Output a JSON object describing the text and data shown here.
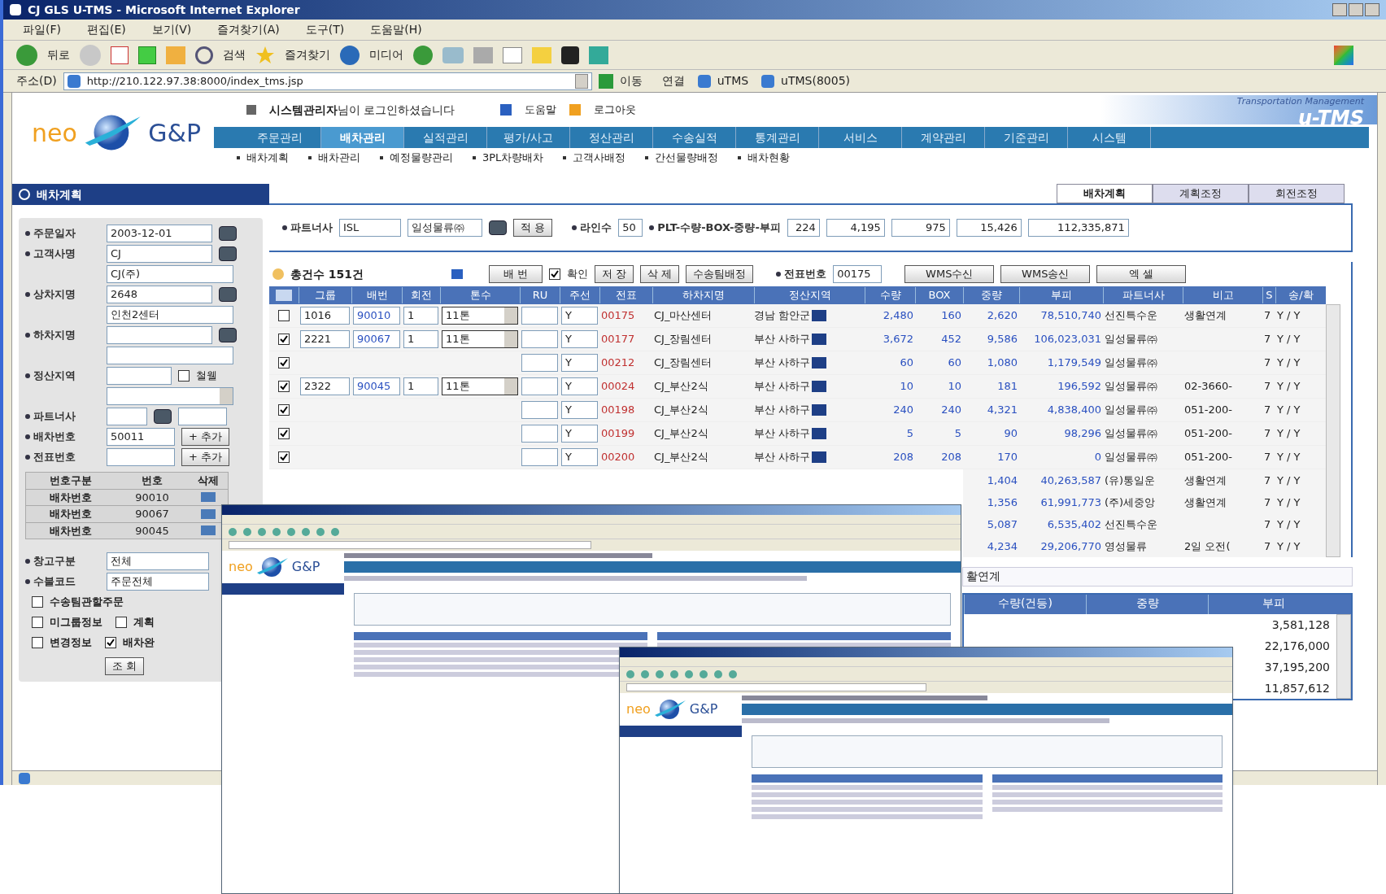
{
  "window": {
    "title": "CJ GLS U-TMS - Microsoft Internet Explorer",
    "menu": [
      "파일(F)",
      "편집(E)",
      "보기(V)",
      "즐겨찾기(A)",
      "도구(T)",
      "도움말(H)"
    ],
    "toolbar": {
      "back": "뒤로",
      "search": "검색",
      "favorites": "즐겨찾기",
      "media": "미디어"
    },
    "address": {
      "label": "주소(D)",
      "url": "http://210.122.97.38:8000/index_tms.jsp",
      "go": "이동",
      "links_label": "연결",
      "links": [
        "uTMS",
        "uTMS(8005)"
      ]
    }
  },
  "header": {
    "logo_left": "neo",
    "logo_right": "G&P",
    "login_message": "**시스템관리자**님이 로그인하셨습니다",
    "help": "도움말",
    "logout": "로그아웃",
    "tagline": "Transportation Management",
    "brand": "u-TMS"
  },
  "nav": [
    {
      "label": "주문관리",
      "selected": false
    },
    {
      "label": "배차관리",
      "selected": true
    },
    {
      "label": "실적관리",
      "selected": false
    },
    {
      "label": "평가/사고",
      "selected": false
    },
    {
      "label": "정산관리",
      "selected": false
    },
    {
      "label": "수송실적",
      "selected": false
    },
    {
      "label": "통계관리",
      "selected": false
    },
    {
      "label": "서비스",
      "selected": false
    },
    {
      "label": "계약관리",
      "selected": false
    },
    {
      "label": "기준관리",
      "selected": false
    },
    {
      "label": "시스템",
      "selected": false
    }
  ],
  "subnav": [
    "배차계획",
    "배차관리",
    "예정물량관리",
    "3PL차량배차",
    "고객사배정",
    "간선물량배정",
    "배차현황"
  ],
  "sidebar": {
    "title": "배차계획",
    "fields": [
      {
        "label": "주문일자",
        "value": "2003-12-01",
        "kind": "lookup"
      },
      {
        "label": "고객사명",
        "value": "CJ",
        "value2": "CJ(주)",
        "kind": "lookup2"
      },
      {
        "label": "상차지명",
        "value": "2648",
        "value2": "인천2센터",
        "kind": "lookup2"
      },
      {
        "label": "하차지명",
        "kind": "lookup2"
      },
      {
        "label": "정산지역",
        "check_label": "철웰",
        "checked": false,
        "kind": "region"
      },
      {
        "label": "파트너사",
        "kind": "partner"
      },
      {
        "label": "배차번호",
        "value": "50011",
        "button": "+ 추가",
        "kind": "add"
      },
      {
        "label": "전표번호",
        "button": "+ 추가",
        "kind": "add"
      }
    ],
    "numbers": {
      "columns": [
        "번호구분",
        "번호",
        "삭제"
      ],
      "rows": [
        [
          "배차번호",
          "90010"
        ],
        [
          "배차번호",
          "90067"
        ],
        [
          "배차번호",
          "90045"
        ]
      ]
    },
    "fields2": [
      {
        "label": "창고구분",
        "value": "전체"
      },
      {
        "label": "수불코드",
        "value": "주문전체"
      }
    ],
    "checks": [
      [
        {
          "label": "수송팀관할주문",
          "checked": false
        }
      ],
      [
        {
          "label": "미그룹정보",
          "checked": false
        },
        {
          "label": "계획",
          "checked": false
        }
      ],
      [
        {
          "label": "변경정보",
          "checked": false
        },
        {
          "label": "배차완",
          "checked": true
        }
      ]
    ],
    "search_button": "조 회"
  },
  "tabs": [
    {
      "label": "배차계획",
      "selected": true
    },
    {
      "label": "계획조정",
      "selected": false
    },
    {
      "label": "회전조정",
      "selected": false
    }
  ],
  "partner_row": {
    "label": "파트너사",
    "code": "ISL",
    "name": "일성물류㈜",
    "apply": "적 용",
    "lines_label": "라인수",
    "lines": "50",
    "totals_label": "PLT-수량-BOX-중량-부피",
    "totals": [
      "224",
      "4,195",
      "975",
      "15,426",
      "112,335,871"
    ]
  },
  "action_bar": {
    "count": "총건수 151건",
    "number_button": "배 번",
    "confirm": {
      "label": "확인",
      "checked": true
    },
    "buttons": [
      "저 장",
      "삭 제",
      "수송팀배정"
    ],
    "slip_label": "전표번호",
    "slip": "00175",
    "buttons2": [
      "WMS수신",
      "WMS송신",
      "엑 셀"
    ]
  },
  "table": {
    "columns": [
      "그룹",
      "배번",
      "회전",
      "톤수",
      "RU",
      "주선",
      "전표",
      "하차지명",
      "정산지역",
      "수량",
      "BOX",
      "중량",
      "부피",
      "파트너사",
      "비고",
      "S",
      "송/확"
    ],
    "rows": [
      {
        "checked": false,
        "cells": [
          "1016",
          "90010",
          "1",
          "11톤",
          "",
          "Y",
          "00175",
          "CJ_마산센터",
          "경남 함안군",
          "2,480",
          "160",
          "2,620",
          "78,510,740",
          "선진특수운",
          "생활연계",
          "7",
          "Y / Y"
        ]
      },
      {
        "checked": true,
        "cells": [
          "2221",
          "90067",
          "1",
          "11톤",
          "",
          "Y",
          "00177",
          "CJ_장림센터",
          "부산 사하구",
          "3,672",
          "452",
          "9,586",
          "106,023,031",
          "일성물류㈜",
          "",
          "7",
          "Y / Y"
        ]
      },
      {
        "checked": true,
        "cells": [
          "",
          "",
          "",
          "",
          "",
          "Y",
          "00212",
          "CJ_장림센터",
          "부산 사하구",
          "60",
          "60",
          "1,080",
          "1,179,549",
          "일성물류㈜",
          "",
          "7",
          "Y / Y"
        ]
      },
      {
        "checked": true,
        "cells": [
          "2322",
          "90045",
          "1",
          "11톤",
          "",
          "Y",
          "00024",
          "CJ_부산2식",
          "부산 사하구",
          "10",
          "10",
          "181",
          "196,592",
          "일성물류㈜",
          "02-3660-",
          "7",
          "Y / Y"
        ]
      },
      {
        "checked": true,
        "cells": [
          "",
          "",
          "",
          "",
          "",
          "Y",
          "00198",
          "CJ_부산2식",
          "부산 사하구",
          "240",
          "240",
          "4,321",
          "4,838,400",
          "일성물류㈜",
          "051-200-",
          "7",
          "Y / Y"
        ]
      },
      {
        "checked": true,
        "cells": [
          "",
          "",
          "",
          "",
          "",
          "Y",
          "00199",
          "CJ_부산2식",
          "부산 사하구",
          "5",
          "5",
          "90",
          "98,296",
          "일성물류㈜",
          "051-200-",
          "7",
          "Y / Y"
        ]
      },
      {
        "checked": true,
        "cells": [
          "",
          "",
          "",
          "",
          "",
          "Y",
          "00200",
          "CJ_부산2식",
          "부산 사하구",
          "208",
          "208",
          "170",
          "0",
          "일성물류㈜",
          "051-200-",
          "7",
          "Y / Y"
        ]
      }
    ],
    "partial_rows": [
      [
        "1,404",
        "40,263,587",
        "(유)통일운",
        "생활연계",
        "7",
        "Y / Y"
      ],
      [
        "1,356",
        "61,991,773",
        "(주)세중앙",
        "생활연계",
        "7",
        "Y / Y"
      ],
      [
        "5,087",
        "6,535,402",
        "선진특수운",
        "",
        "7",
        "Y / Y"
      ],
      [
        "4,234",
        "29,206,770",
        "영성물류",
        "2일 오전(",
        "7",
        "Y / Y"
      ]
    ]
  },
  "memo": "활연계",
  "summary": {
    "columns": [
      "수량(건등)",
      "중량",
      "부피"
    ],
    "values": [
      "3,581,128",
      "22,176,000",
      "37,195,200",
      "11,857,612"
    ]
  },
  "thumbnails": [
    {
      "logo_left": "neo",
      "logo_right": "G&P"
    },
    {
      "logo_left": "neo",
      "logo_right": "G&P"
    }
  ]
}
